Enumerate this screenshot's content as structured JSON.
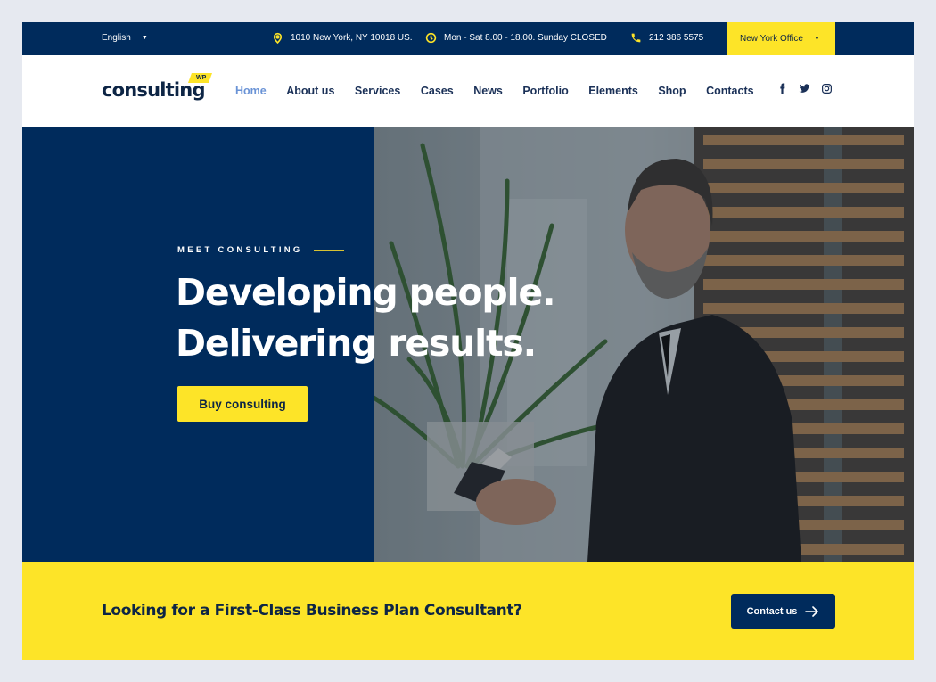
{
  "topbar": {
    "language": "English",
    "address": "1010 New York, NY 10018 US.",
    "hours": "Mon - Sat 8.00 - 18.00. Sunday CLOSED",
    "phone": "212 386 5575",
    "office": "New York Office",
    "icons": {
      "address": "map-pin-icon",
      "hours": "clock-icon",
      "phone": "phone-icon"
    }
  },
  "header": {
    "logo_text": "consulting",
    "logo_badge": "WP",
    "nav": [
      {
        "label": "Home",
        "active": true
      },
      {
        "label": "About us"
      },
      {
        "label": "Services"
      },
      {
        "label": "Cases"
      },
      {
        "label": "News"
      },
      {
        "label": "Portfolio"
      },
      {
        "label": "Elements"
      },
      {
        "label": "Shop"
      },
      {
        "label": "Contacts"
      }
    ],
    "social": [
      "facebook-icon",
      "twitter-icon",
      "instagram-icon"
    ]
  },
  "hero": {
    "eyebrow": "MEET CONSULTING",
    "headline_line1": "Developing people.",
    "headline_line2": "Delivering results.",
    "button": "Buy consulting",
    "image_alt": "Businessman with tablet in office"
  },
  "cta": {
    "text": "Looking for a First-Class Business Plan Consultant?",
    "button": "Contact us"
  },
  "colors": {
    "navy": "#002b5c",
    "yellow": "#fde428",
    "text_dark": "#0d2545",
    "nav_active": "#6a93d6",
    "page_bg": "#e6e9f0"
  }
}
